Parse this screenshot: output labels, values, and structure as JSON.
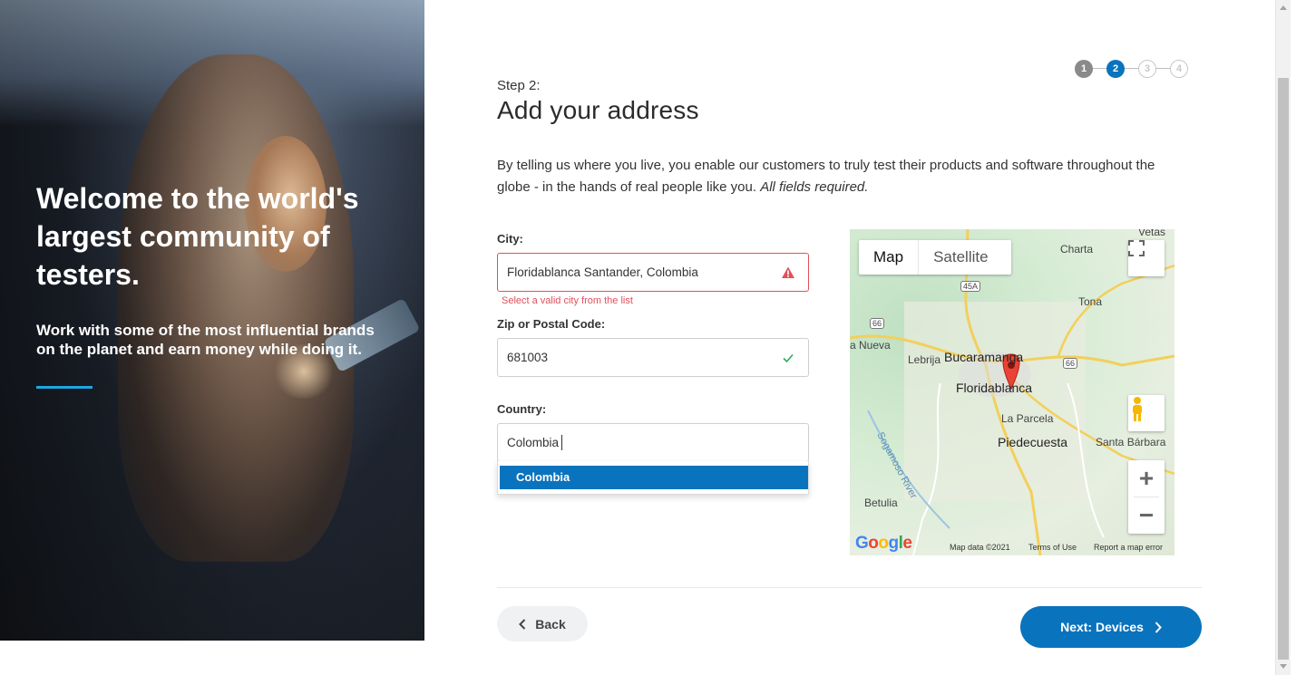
{
  "hero": {
    "title": "Welcome to the world's largest community of testers.",
    "subtitle": "Work with some of the most influential brands on the planet and earn money while doing it."
  },
  "stepper": {
    "steps": [
      "1",
      "2",
      "3",
      "4"
    ],
    "current": 2
  },
  "step_label": "Step 2:",
  "title": "Add your address",
  "intro": "By telling us where you live, you enable our customers to truly test their products and software throughout the globe - in the hands of real people like you.",
  "intro_emphasis": "All fields required.",
  "city": {
    "label": "City:",
    "value": "Floridablanca Santander, Colombia",
    "error": "Select a valid city from the list"
  },
  "zip": {
    "label": "Zip or Postal Code:",
    "value": "681003"
  },
  "country": {
    "label": "Country:",
    "value": "Colombia",
    "options": [
      "Colombia"
    ]
  },
  "map": {
    "tab_map": "Map",
    "tab_satellite": "Satellite",
    "places": {
      "bucaramanga": "Bucaramanga",
      "floridablanca": "Floridablanca",
      "la_parcela": "La Parcela",
      "piedecuesta": "Piedecuesta",
      "santa_barbara": "Santa Bárbara",
      "lebrija": "Lebrija",
      "nueva": "a Nueva",
      "charta": "Charta",
      "tona": "Tona",
      "betulia": "Betulia",
      "vetas": "Vetas",
      "river": "Sogamoso River"
    },
    "shields": {
      "s45a": "45A",
      "s66a": "66",
      "s66b": "66"
    },
    "footer_data": "Map data ©2021",
    "footer_terms": "Terms of Use",
    "footer_report": "Report a map error",
    "logo": "Google"
  },
  "buttons": {
    "back": "Back",
    "next": "Next: Devices"
  },
  "colors": {
    "primary": "#0a73bd",
    "error": "#e0505a",
    "success": "#2bab5a",
    "accent": "#1ea7e1"
  }
}
